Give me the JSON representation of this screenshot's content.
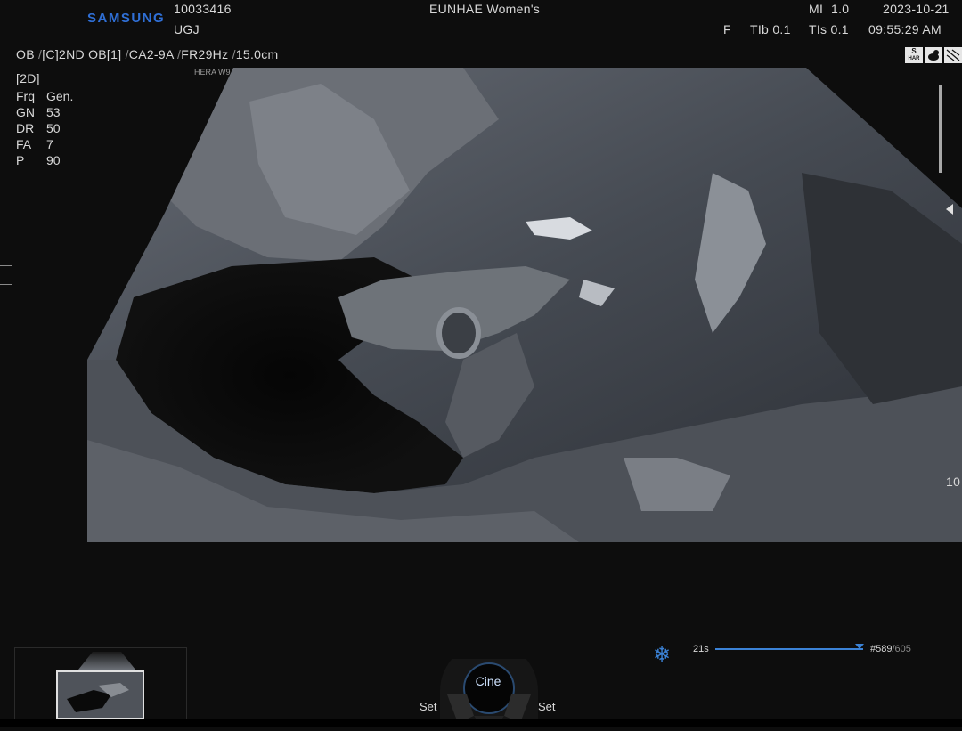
{
  "header": {
    "brand": "SAMSUNG",
    "patient_id": "10033416",
    "patient_name": "UGJ",
    "institution": "EUNHAE Women's",
    "mi_label": "MI",
    "mi_value": "1.0",
    "date": "2023-10-21",
    "focus": "F",
    "tib": "TIb 0.1",
    "tis": "TIs 0.1",
    "time": "09:55:29 AM"
  },
  "preset_line": {
    "exam": "OB",
    "preset": "[C]2ND OB[1]",
    "probe": "CA2-9A",
    "frame_rate": "FR29Hz",
    "depth": "15.0cm",
    "system": "HERA W9"
  },
  "mode": {
    "label": "[2D]",
    "params": [
      {
        "key": "Frq",
        "value": "Gen."
      },
      {
        "key": "GN",
        "value": "53"
      },
      {
        "key": "DR",
        "value": "50"
      },
      {
        "key": "FA",
        "value": "7"
      },
      {
        "key": "P",
        "value": "90"
      }
    ]
  },
  "status_icons": [
    {
      "name": "s-har-icon",
      "top": "S",
      "bottom": "HAR"
    },
    {
      "name": "fetus-icon",
      "top": "",
      "bottom": ""
    },
    {
      "name": "grid-icon",
      "top": "",
      "bottom": ""
    }
  ],
  "depth_marker": "10",
  "cine": {
    "label": "Cine",
    "left_set": "Set",
    "right_set": "Set",
    "time": "21s",
    "frame_current": "#589",
    "frame_total": "/605",
    "progress": 0.973
  },
  "colors": {
    "brand": "#2f6fd6",
    "accent": "#3b82d6",
    "text": "#d8d8d8",
    "background": "#0d0d0d"
  }
}
